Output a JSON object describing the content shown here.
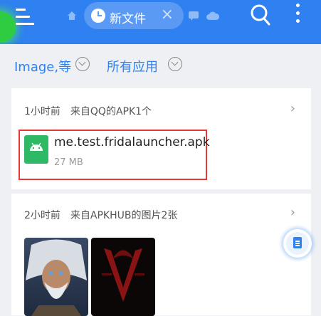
{
  "header": {
    "tab_label": "新文件",
    "tab_close": "×",
    "icons": [
      "menu-icon",
      "home-icon",
      "clock-icon",
      "close-icon",
      "chat-icon",
      "cloud-icon",
      "search-icon",
      "more-vertical-icon"
    ]
  },
  "filters": {
    "type_label": "Image,等",
    "app_label": "所有应用"
  },
  "groups": [
    {
      "header": "1小时前　来自QQ的APK1个",
      "files": [
        {
          "name": "me.test.fridalauncher.apk",
          "size": "27 MB",
          "icon": "android-apk-icon"
        }
      ]
    },
    {
      "header": "2小时前　来自APKHUB的图片2张",
      "images": [
        "warrior-portrait-thumbnail",
        "dark-red-logo-thumbnail"
      ]
    }
  ],
  "colors": {
    "primary": "#2f80f0",
    "apk_green": "#2fb866",
    "highlight_red": "#e53935"
  }
}
